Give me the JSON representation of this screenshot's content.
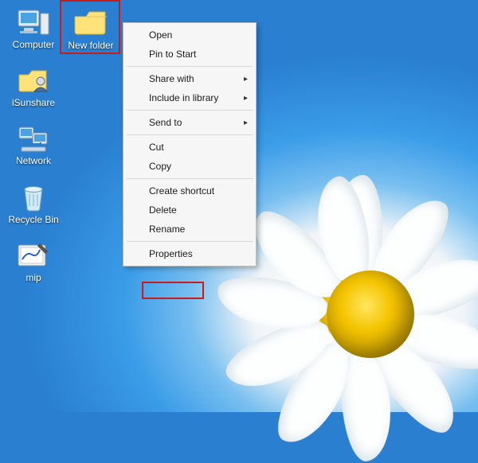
{
  "desktop": {
    "icons": [
      {
        "name": "computer",
        "label": "Computer"
      },
      {
        "name": "isunshare",
        "label": "iSunshare"
      },
      {
        "name": "network",
        "label": "Network"
      },
      {
        "name": "recycle-bin",
        "label": "Recycle Bin"
      },
      {
        "name": "mip",
        "label": "mip"
      }
    ],
    "secondary_icon": {
      "name": "new-folder",
      "label": "New folder"
    }
  },
  "context_menu": {
    "items": [
      {
        "key": "open",
        "label": "Open",
        "submenu": false
      },
      {
        "key": "pin",
        "label": "Pin to Start",
        "submenu": false
      },
      {
        "sep": true
      },
      {
        "key": "share",
        "label": "Share with",
        "submenu": true
      },
      {
        "key": "library",
        "label": "Include in library",
        "submenu": true
      },
      {
        "sep": true
      },
      {
        "key": "sendto",
        "label": "Send to",
        "submenu": true
      },
      {
        "sep": true
      },
      {
        "key": "cut",
        "label": "Cut",
        "submenu": false
      },
      {
        "key": "copy",
        "label": "Copy",
        "submenu": false
      },
      {
        "sep": true
      },
      {
        "key": "shortcut",
        "label": "Create shortcut",
        "submenu": false
      },
      {
        "key": "delete",
        "label": "Delete",
        "submenu": false
      },
      {
        "key": "rename",
        "label": "Rename",
        "submenu": false
      },
      {
        "sep": true
      },
      {
        "key": "properties",
        "label": "Properties",
        "submenu": false
      }
    ],
    "submenu_arrow": "▸"
  }
}
